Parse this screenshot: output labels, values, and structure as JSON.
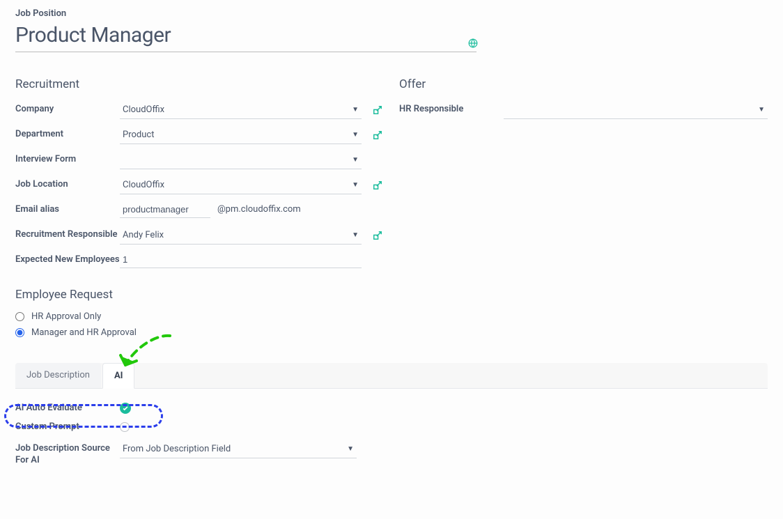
{
  "header": {
    "field_label": "Job Position",
    "title": "Product Manager"
  },
  "recruitment": {
    "heading": "Recruitment",
    "company_label": "Company",
    "company_value": "CloudOffix",
    "department_label": "Department",
    "department_value": "Product",
    "interview_form_label": "Interview Form",
    "interview_form_value": "",
    "job_location_label": "Job Location",
    "job_location_value": "CloudOffix",
    "email_alias_label": "Email alias",
    "email_alias_value": "productmanager",
    "email_domain": "@pm.cloudoffix.com",
    "recruitment_responsible_label": "Recruitment Responsible",
    "recruitment_responsible_value": "Andy Felix",
    "expected_new_label": "Expected New Employees",
    "expected_new_value": "1"
  },
  "offer": {
    "heading": "Offer",
    "hr_responsible_label": "HR Responsible",
    "hr_responsible_value": ""
  },
  "employee_request": {
    "heading": "Employee Request",
    "option1": "HR Approval Only",
    "option2": "Manager and HR Approval"
  },
  "tabs": {
    "tab1": "Job Description",
    "tab2": "AI"
  },
  "ai_panel": {
    "auto_evaluate_label": "AI Auto Evaluate",
    "custom_prompt_label": "Custom Prompt",
    "jd_source_label": "Job Description Source For AI",
    "jd_source_value": "From Job Description Field"
  }
}
